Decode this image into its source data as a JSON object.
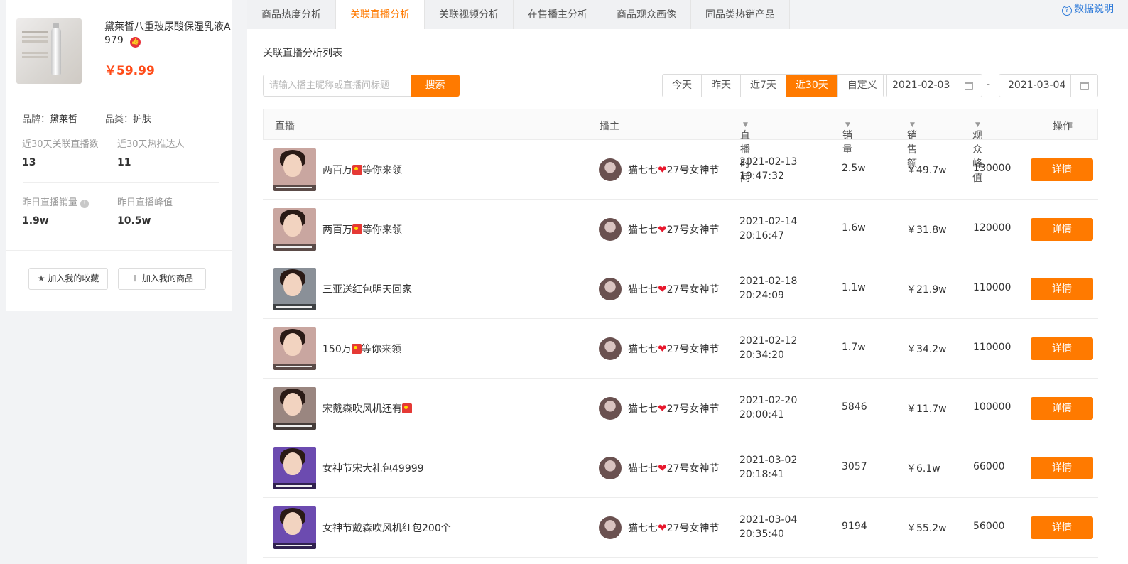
{
  "product": {
    "name": "黛莱皙八重玻尿酸保湿乳液A",
    "code": "979",
    "price": "￥59.99",
    "brand_label": "品牌：",
    "brand": "黛莱皙",
    "category_label": "品类：",
    "category": "护肤",
    "stats": [
      {
        "label": "近30天关联直播数",
        "value": "13"
      },
      {
        "label": "近30天热推达人",
        "value": "11"
      },
      {
        "label": "昨日直播销量",
        "value": "1.9w"
      },
      {
        "label": "昨日直播峰值",
        "value": "10.5w"
      }
    ],
    "favorite_label": "加入我的收藏",
    "add_product_label": "加入我的商品"
  },
  "tabs": [
    {
      "label": "商品热度分析",
      "active": false
    },
    {
      "label": "关联直播分析",
      "active": true
    },
    {
      "label": "关联视频分析",
      "active": false
    },
    {
      "label": "在售播主分析",
      "active": false
    },
    {
      "label": "商品观众画像",
      "active": false
    },
    {
      "label": "同品类热销产品",
      "active": false
    }
  ],
  "help_label": "数据说明",
  "section_title": "关联直播分析列表",
  "search": {
    "placeholder": "请输入播主昵称或直播间标题",
    "value": "",
    "button": "搜索"
  },
  "ranges": [
    {
      "label": "今天",
      "active": false
    },
    {
      "label": "昨天",
      "active": false
    },
    {
      "label": "近7天",
      "active": false
    },
    {
      "label": "近30天",
      "active": true
    },
    {
      "label": "自定义",
      "active": false
    }
  ],
  "date_start": "2021-02-03",
  "date_end": "2021-03-04",
  "date_separator": "-",
  "columns": {
    "live": "直播",
    "anchor": "播主",
    "time": "直播时间",
    "sales": "销量",
    "amount": "销售额",
    "peak": "观众峰值",
    "action": "操作"
  },
  "rows": [
    {
      "title_pre": "两百万",
      "flag_pos": "mid",
      "title_post": "等你来领",
      "anchor": "猫七七",
      "anchor_suffix": "27号女神节",
      "date": "2021-02-13",
      "time": "19:47:32",
      "sales": "2.5w",
      "amount": "￥49.7w",
      "peak": "130000",
      "action": "详情"
    },
    {
      "title_pre": "两百万",
      "flag_pos": "mid",
      "title_post": "等你来领",
      "anchor": "猫七七",
      "anchor_suffix": "27号女神节",
      "date": "2021-02-14",
      "time": "20:16:47",
      "sales": "1.6w",
      "amount": "￥31.8w",
      "peak": "120000",
      "action": "详情"
    },
    {
      "title_pre": "三亚送红包明天回家",
      "flag_pos": "none",
      "title_post": "",
      "anchor": "猫七七",
      "anchor_suffix": "27号女神节",
      "date": "2021-02-18",
      "time": "20:24:09",
      "sales": "1.1w",
      "amount": "￥21.9w",
      "peak": "110000",
      "action": "详情"
    },
    {
      "title_pre": "150万",
      "flag_pos": "mid",
      "title_post": "等你来领",
      "anchor": "猫七七",
      "anchor_suffix": "27号女神节",
      "date": "2021-02-12",
      "time": "20:34:20",
      "sales": "1.7w",
      "amount": "￥34.2w",
      "peak": "110000",
      "action": "详情"
    },
    {
      "title_pre": "宋戴森吹风机还有",
      "flag_pos": "end",
      "title_post": "",
      "anchor": "猫七七",
      "anchor_suffix": "27号女神节",
      "date": "2021-02-20",
      "time": "20:00:41",
      "sales": "5846",
      "amount": "￥11.7w",
      "peak": "100000",
      "action": "详情"
    },
    {
      "title_pre": "女神节宋大礼包49999",
      "flag_pos": "none",
      "title_post": "",
      "anchor": "猫七七",
      "anchor_suffix": "27号女神节",
      "date": "2021-03-02",
      "time": "20:18:41",
      "sales": "3057",
      "amount": "￥6.1w",
      "peak": "66000",
      "action": "详情"
    },
    {
      "title_pre": "女神节戴森吹风机红包200个",
      "flag_pos": "none",
      "title_post": "",
      "anchor": "猫七七",
      "anchor_suffix": "27号女神节",
      "date": "2021-03-04",
      "time": "20:35:40",
      "sales": "9194",
      "amount": "￥55.2w",
      "peak": "56000",
      "action": "详情"
    }
  ],
  "colors": {
    "accent": "#ff7a00",
    "price": "#ff4b18",
    "link": "#2f7bd9",
    "heart": "#e8182d"
  },
  "icons": {
    "favorite": "star-icon",
    "add": "plus-icon",
    "help": "question-circle-icon",
    "calendar": "calendar-icon",
    "sort": "caret-down-icon"
  }
}
